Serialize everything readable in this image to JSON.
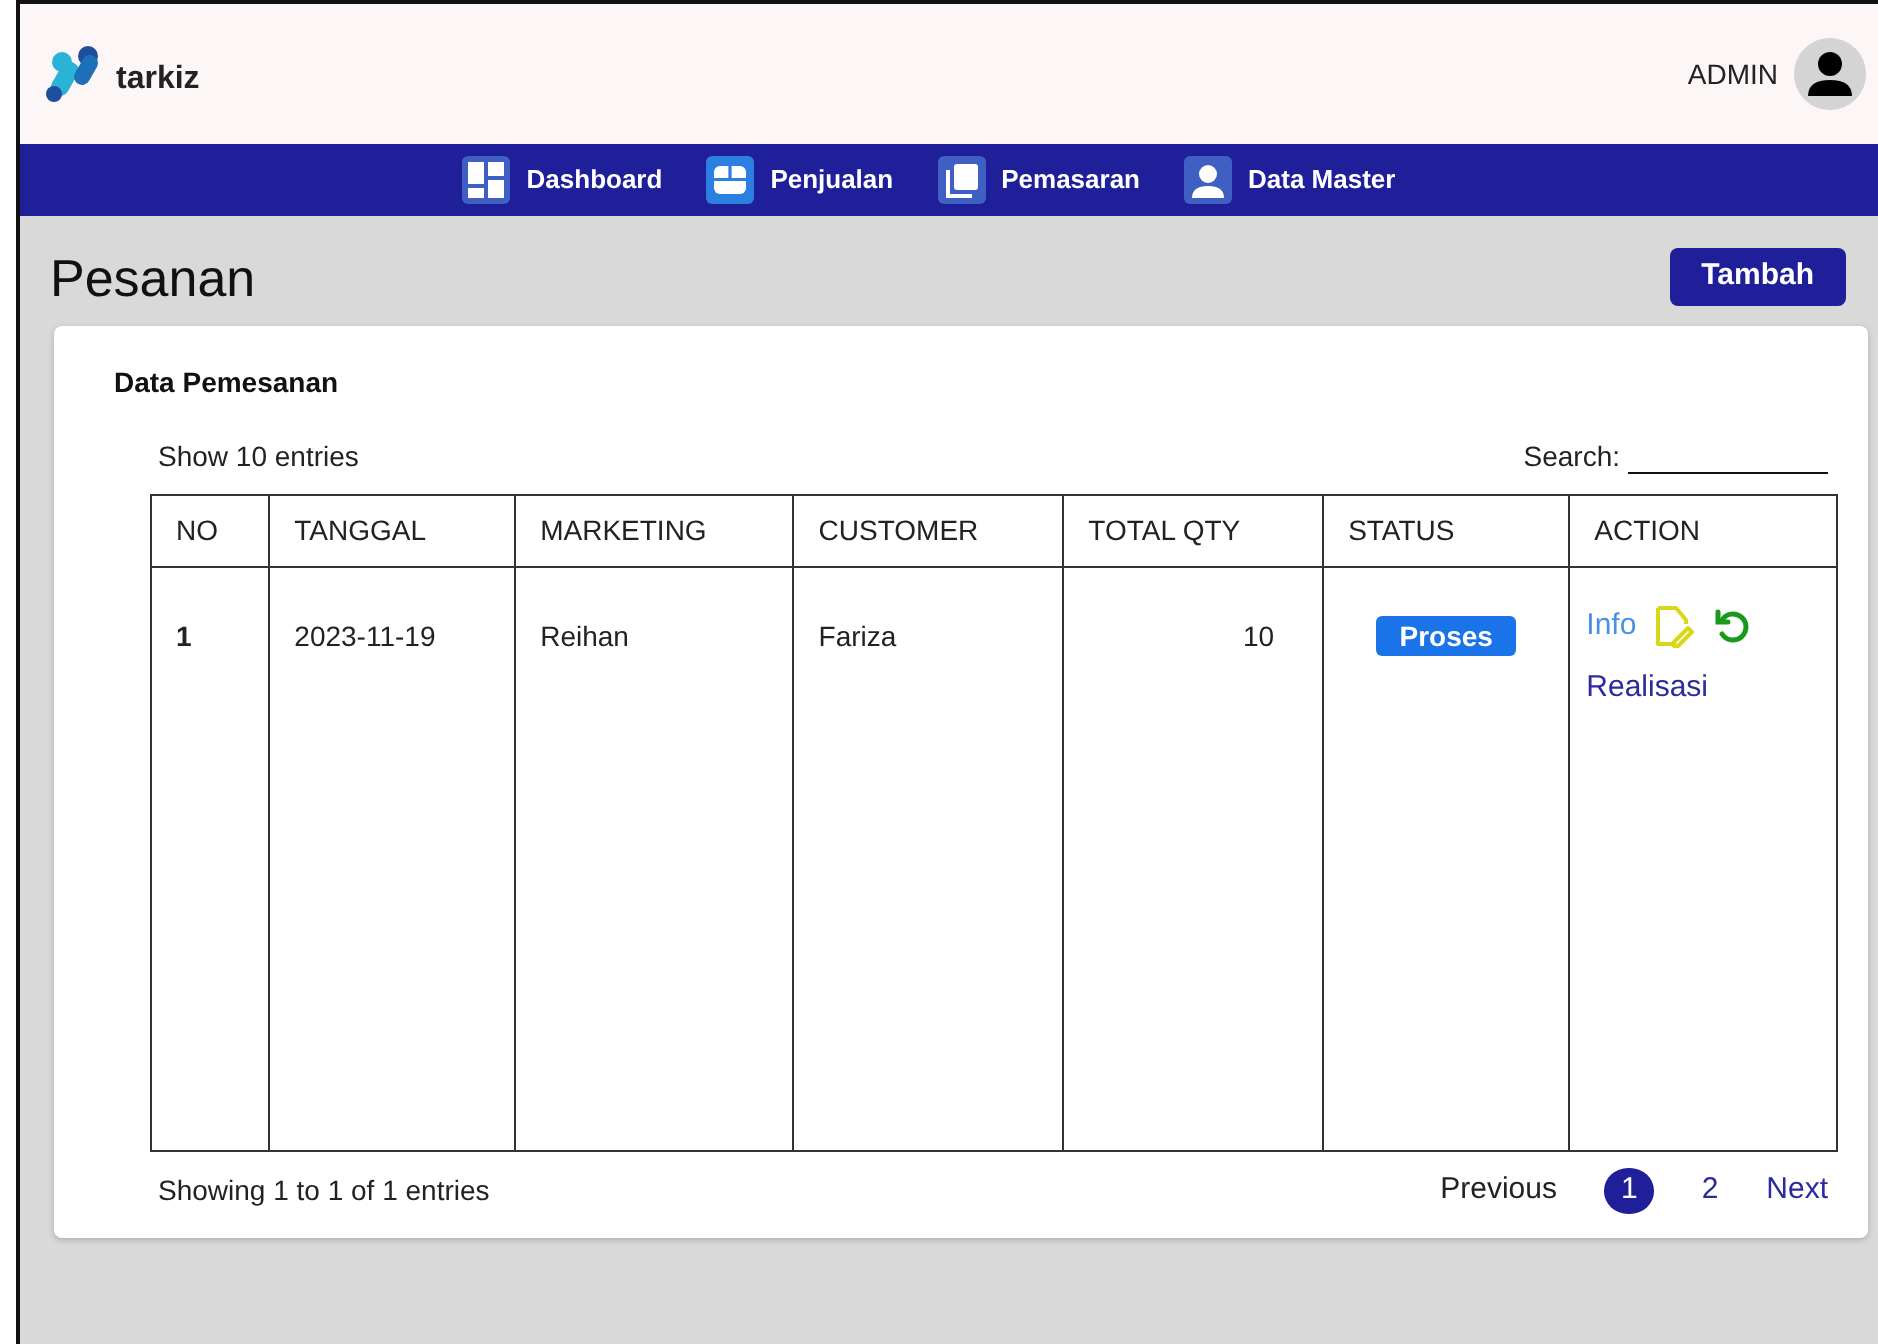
{
  "header": {
    "logo": "tarkiz",
    "user": "ADMIN"
  },
  "nav": [
    {
      "label": "Dashboard"
    },
    {
      "label": "Penjualan"
    },
    {
      "label": "Pemasaran"
    },
    {
      "label": "Data Master"
    }
  ],
  "page": {
    "title": "Pesanan",
    "add_button": "Tambah"
  },
  "card": {
    "title": "Data Pemesanan",
    "length": "Show 10 entries",
    "search": {
      "label": "Search:"
    },
    "table": {
      "columns": [
        "NO",
        "TANGGAL",
        "MARKETING",
        "CUSTOMER",
        "TOTAL QTY",
        "STATUS",
        "ACTION"
      ],
      "rows": [
        {
          "no": "1",
          "tanggal": "2023-11-19",
          "marketing": "Reihan",
          "customer": "Fariza",
          "total_qty": "10",
          "status": "Proses",
          "actions": {
            "info": "Info",
            "realisasi": "Realisasi"
          }
        }
      ]
    },
    "info": "Showing 1 to 1 of 1 entries",
    "pagination": {
      "previous": "Previous",
      "pages": [
        {
          "label": "1",
          "selected": true
        },
        {
          "label": "2",
          "selected": false
        }
      ],
      "next": "Next"
    }
  }
}
